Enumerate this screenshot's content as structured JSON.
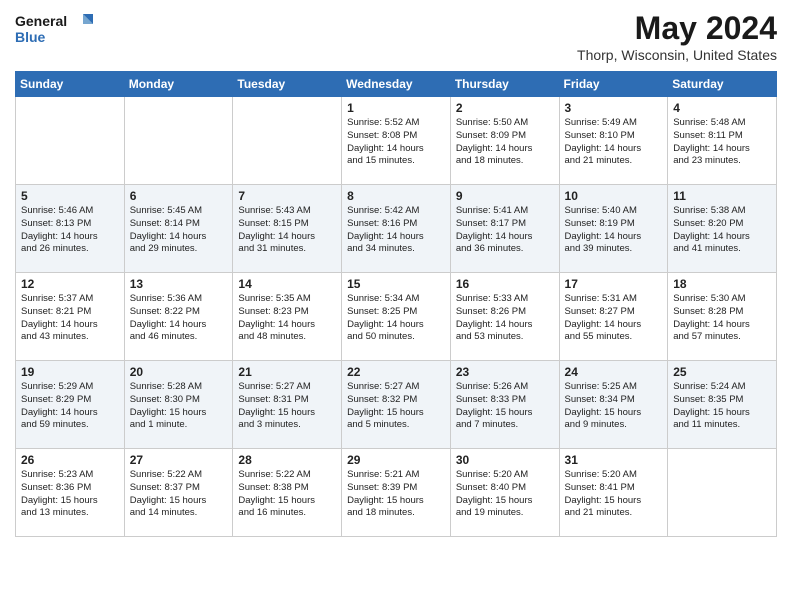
{
  "header": {
    "logo_line1": "General",
    "logo_line2": "Blue",
    "month_year": "May 2024",
    "location": "Thorp, Wisconsin, United States"
  },
  "weekdays": [
    "Sunday",
    "Monday",
    "Tuesday",
    "Wednesday",
    "Thursday",
    "Friday",
    "Saturday"
  ],
  "weeks": [
    [
      {
        "day": "",
        "info": ""
      },
      {
        "day": "",
        "info": ""
      },
      {
        "day": "",
        "info": ""
      },
      {
        "day": "1",
        "info": "Sunrise: 5:52 AM\nSunset: 8:08 PM\nDaylight: 14 hours\nand 15 minutes."
      },
      {
        "day": "2",
        "info": "Sunrise: 5:50 AM\nSunset: 8:09 PM\nDaylight: 14 hours\nand 18 minutes."
      },
      {
        "day": "3",
        "info": "Sunrise: 5:49 AM\nSunset: 8:10 PM\nDaylight: 14 hours\nand 21 minutes."
      },
      {
        "day": "4",
        "info": "Sunrise: 5:48 AM\nSunset: 8:11 PM\nDaylight: 14 hours\nand 23 minutes."
      }
    ],
    [
      {
        "day": "5",
        "info": "Sunrise: 5:46 AM\nSunset: 8:13 PM\nDaylight: 14 hours\nand 26 minutes."
      },
      {
        "day": "6",
        "info": "Sunrise: 5:45 AM\nSunset: 8:14 PM\nDaylight: 14 hours\nand 29 minutes."
      },
      {
        "day": "7",
        "info": "Sunrise: 5:43 AM\nSunset: 8:15 PM\nDaylight: 14 hours\nand 31 minutes."
      },
      {
        "day": "8",
        "info": "Sunrise: 5:42 AM\nSunset: 8:16 PM\nDaylight: 14 hours\nand 34 minutes."
      },
      {
        "day": "9",
        "info": "Sunrise: 5:41 AM\nSunset: 8:17 PM\nDaylight: 14 hours\nand 36 minutes."
      },
      {
        "day": "10",
        "info": "Sunrise: 5:40 AM\nSunset: 8:19 PM\nDaylight: 14 hours\nand 39 minutes."
      },
      {
        "day": "11",
        "info": "Sunrise: 5:38 AM\nSunset: 8:20 PM\nDaylight: 14 hours\nand 41 minutes."
      }
    ],
    [
      {
        "day": "12",
        "info": "Sunrise: 5:37 AM\nSunset: 8:21 PM\nDaylight: 14 hours\nand 43 minutes."
      },
      {
        "day": "13",
        "info": "Sunrise: 5:36 AM\nSunset: 8:22 PM\nDaylight: 14 hours\nand 46 minutes."
      },
      {
        "day": "14",
        "info": "Sunrise: 5:35 AM\nSunset: 8:23 PM\nDaylight: 14 hours\nand 48 minutes."
      },
      {
        "day": "15",
        "info": "Sunrise: 5:34 AM\nSunset: 8:25 PM\nDaylight: 14 hours\nand 50 minutes."
      },
      {
        "day": "16",
        "info": "Sunrise: 5:33 AM\nSunset: 8:26 PM\nDaylight: 14 hours\nand 53 minutes."
      },
      {
        "day": "17",
        "info": "Sunrise: 5:31 AM\nSunset: 8:27 PM\nDaylight: 14 hours\nand 55 minutes."
      },
      {
        "day": "18",
        "info": "Sunrise: 5:30 AM\nSunset: 8:28 PM\nDaylight: 14 hours\nand 57 minutes."
      }
    ],
    [
      {
        "day": "19",
        "info": "Sunrise: 5:29 AM\nSunset: 8:29 PM\nDaylight: 14 hours\nand 59 minutes."
      },
      {
        "day": "20",
        "info": "Sunrise: 5:28 AM\nSunset: 8:30 PM\nDaylight: 15 hours\nand 1 minute."
      },
      {
        "day": "21",
        "info": "Sunrise: 5:27 AM\nSunset: 8:31 PM\nDaylight: 15 hours\nand 3 minutes."
      },
      {
        "day": "22",
        "info": "Sunrise: 5:27 AM\nSunset: 8:32 PM\nDaylight: 15 hours\nand 5 minutes."
      },
      {
        "day": "23",
        "info": "Sunrise: 5:26 AM\nSunset: 8:33 PM\nDaylight: 15 hours\nand 7 minutes."
      },
      {
        "day": "24",
        "info": "Sunrise: 5:25 AM\nSunset: 8:34 PM\nDaylight: 15 hours\nand 9 minutes."
      },
      {
        "day": "25",
        "info": "Sunrise: 5:24 AM\nSunset: 8:35 PM\nDaylight: 15 hours\nand 11 minutes."
      }
    ],
    [
      {
        "day": "26",
        "info": "Sunrise: 5:23 AM\nSunset: 8:36 PM\nDaylight: 15 hours\nand 13 minutes."
      },
      {
        "day": "27",
        "info": "Sunrise: 5:22 AM\nSunset: 8:37 PM\nDaylight: 15 hours\nand 14 minutes."
      },
      {
        "day": "28",
        "info": "Sunrise: 5:22 AM\nSunset: 8:38 PM\nDaylight: 15 hours\nand 16 minutes."
      },
      {
        "day": "29",
        "info": "Sunrise: 5:21 AM\nSunset: 8:39 PM\nDaylight: 15 hours\nand 18 minutes."
      },
      {
        "day": "30",
        "info": "Sunrise: 5:20 AM\nSunset: 8:40 PM\nDaylight: 15 hours\nand 19 minutes."
      },
      {
        "day": "31",
        "info": "Sunrise: 5:20 AM\nSunset: 8:41 PM\nDaylight: 15 hours\nand 21 minutes."
      },
      {
        "day": "",
        "info": ""
      }
    ]
  ]
}
